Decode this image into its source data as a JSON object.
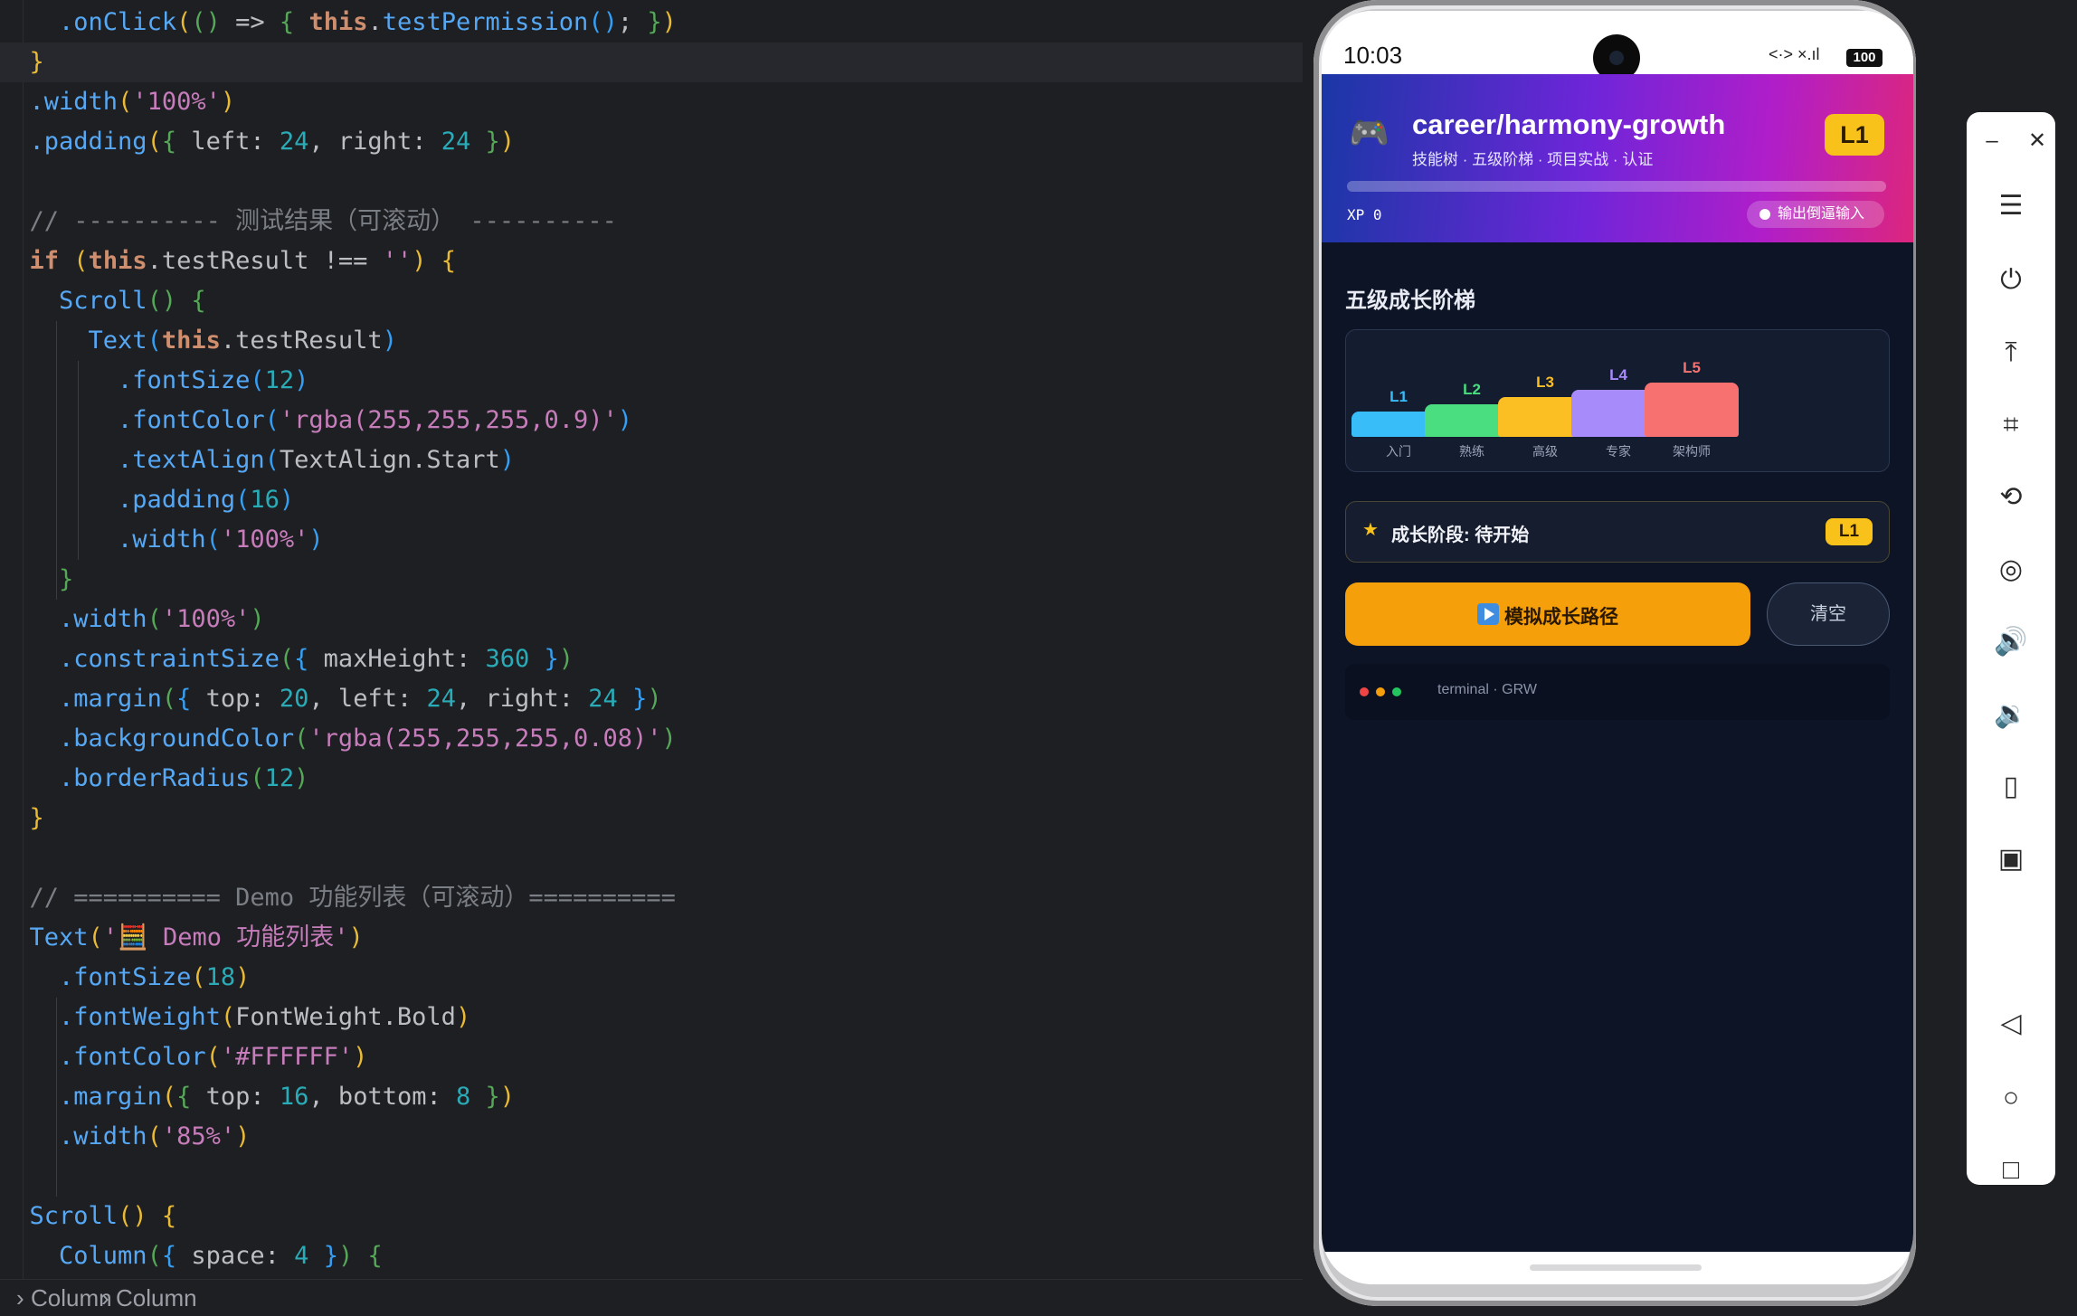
{
  "editor": {
    "lines": [
      [
        [
          "p",
          "    "
        ],
        [
          "fn",
          ".onClick"
        ],
        [
          "p1",
          "("
        ],
        [
          "p2",
          "("
        ],
        [
          "p2",
          ")"
        ],
        [
          "p",
          " => "
        ],
        [
          "p2",
          "{"
        ],
        [
          "p",
          " "
        ],
        [
          "kw",
          "this"
        ],
        [
          "p",
          "."
        ],
        [
          "fn",
          "testPermission"
        ],
        [
          "p3",
          "("
        ],
        [
          "p3",
          ")"
        ],
        [
          "p",
          "; "
        ],
        [
          "p2",
          "}"
        ],
        [
          "p1",
          ")"
        ]
      ],
      [
        [
          "p",
          "  "
        ],
        [
          "p1",
          "}"
        ]
      ],
      [
        [
          "p",
          "  "
        ],
        [
          "fn",
          ".width"
        ],
        [
          "p1",
          "("
        ],
        [
          "str",
          "'100%'"
        ],
        [
          "p1",
          ")"
        ]
      ],
      [
        [
          "p",
          "  "
        ],
        [
          "fn",
          ".padding"
        ],
        [
          "p1",
          "("
        ],
        [
          "p2",
          "{"
        ],
        [
          "p",
          " left: "
        ],
        [
          "num",
          "24"
        ],
        [
          "p",
          ", right: "
        ],
        [
          "num",
          "24"
        ],
        [
          "p",
          " "
        ],
        [
          "p2",
          "}"
        ],
        [
          "p1",
          ")"
        ]
      ],
      [],
      [
        [
          "p",
          "  "
        ],
        [
          "cm",
          "// ---------- 测试结果（可滚动） ----------"
        ]
      ],
      [
        [
          "p",
          "  "
        ],
        [
          "kw",
          "if"
        ],
        [
          "p",
          " "
        ],
        [
          "p1",
          "("
        ],
        [
          "kw",
          "this"
        ],
        [
          "p",
          ".testResult !== "
        ],
        [
          "str",
          "''"
        ],
        [
          "p1",
          ")"
        ],
        [
          "p",
          " "
        ],
        [
          "p1",
          "{"
        ]
      ],
      [
        [
          "p",
          "    "
        ],
        [
          "fn",
          "Scroll"
        ],
        [
          "p2",
          "("
        ],
        [
          "p2",
          ")"
        ],
        [
          "p",
          " "
        ],
        [
          "p2",
          "{"
        ]
      ],
      [
        [
          "p",
          "      "
        ],
        [
          "fn",
          "Text"
        ],
        [
          "p3",
          "("
        ],
        [
          "kw",
          "this"
        ],
        [
          "p",
          ".testResult"
        ],
        [
          "p3",
          ")"
        ]
      ],
      [
        [
          "p",
          "        "
        ],
        [
          "fn",
          ".fontSize"
        ],
        [
          "p3",
          "("
        ],
        [
          "num",
          "12"
        ],
        [
          "p3",
          ")"
        ]
      ],
      [
        [
          "p",
          "        "
        ],
        [
          "fn",
          ".fontColor"
        ],
        [
          "p3",
          "("
        ],
        [
          "str",
          "'rgba(255,255,255,0.9)'"
        ],
        [
          "p3",
          ")"
        ]
      ],
      [
        [
          "p",
          "        "
        ],
        [
          "fn",
          ".textAlign"
        ],
        [
          "p3",
          "("
        ],
        [
          "p",
          "TextAlign.Start"
        ],
        [
          "p3",
          ")"
        ]
      ],
      [
        [
          "p",
          "        "
        ],
        [
          "fn",
          ".padding"
        ],
        [
          "p3",
          "("
        ],
        [
          "num",
          "16"
        ],
        [
          "p3",
          ")"
        ]
      ],
      [
        [
          "p",
          "        "
        ],
        [
          "fn",
          ".width"
        ],
        [
          "p3",
          "("
        ],
        [
          "str",
          "'100%'"
        ],
        [
          "p3",
          ")"
        ]
      ],
      [
        [
          "p",
          "    "
        ],
        [
          "p2",
          "}"
        ]
      ],
      [
        [
          "p",
          "    "
        ],
        [
          "fn",
          ".width"
        ],
        [
          "p2",
          "("
        ],
        [
          "str",
          "'100%'"
        ],
        [
          "p2",
          ")"
        ]
      ],
      [
        [
          "p",
          "    "
        ],
        [
          "fn",
          ".constraintSize"
        ],
        [
          "p2",
          "("
        ],
        [
          "p3",
          "{"
        ],
        [
          "p",
          " maxHeight: "
        ],
        [
          "num",
          "360"
        ],
        [
          "p",
          " "
        ],
        [
          "p3",
          "}"
        ],
        [
          "p2",
          ")"
        ]
      ],
      [
        [
          "p",
          "    "
        ],
        [
          "fn",
          ".margin"
        ],
        [
          "p2",
          "("
        ],
        [
          "p3",
          "{"
        ],
        [
          "p",
          " top: "
        ],
        [
          "num",
          "20"
        ],
        [
          "p",
          ", left: "
        ],
        [
          "num",
          "24"
        ],
        [
          "p",
          ", right: "
        ],
        [
          "num",
          "24"
        ],
        [
          "p",
          " "
        ],
        [
          "p3",
          "}"
        ],
        [
          "p2",
          ")"
        ]
      ],
      [
        [
          "p",
          "    "
        ],
        [
          "fn",
          ".backgroundColor"
        ],
        [
          "p2",
          "("
        ],
        [
          "str",
          "'rgba(255,255,255,0.08)'"
        ],
        [
          "p2",
          ")"
        ]
      ],
      [
        [
          "p",
          "    "
        ],
        [
          "fn",
          ".borderRadius"
        ],
        [
          "p2",
          "("
        ],
        [
          "num",
          "12"
        ],
        [
          "p2",
          ")"
        ]
      ],
      [
        [
          "p",
          "  "
        ],
        [
          "p1",
          "}"
        ]
      ],
      [],
      [
        [
          "p",
          "  "
        ],
        [
          "cm",
          "// ========== Demo 功能列表（可滚动）=========="
        ]
      ],
      [
        [
          "p",
          "  "
        ],
        [
          "fn",
          "Text"
        ],
        [
          "p1",
          "("
        ],
        [
          "str",
          "'🧮 Demo 功能列表'"
        ],
        [
          "p1",
          ")"
        ]
      ],
      [
        [
          "p",
          "    "
        ],
        [
          "fn",
          ".fontSize"
        ],
        [
          "p1",
          "("
        ],
        [
          "num",
          "18"
        ],
        [
          "p1",
          ")"
        ]
      ],
      [
        [
          "p",
          "    "
        ],
        [
          "fn",
          ".fontWeight"
        ],
        [
          "p1",
          "("
        ],
        [
          "p",
          "FontWeight.Bold"
        ],
        [
          "p1",
          ")"
        ]
      ],
      [
        [
          "p",
          "    "
        ],
        [
          "fn",
          ".fontColor"
        ],
        [
          "p1",
          "("
        ],
        [
          "str",
          "'#FFFFFF'"
        ],
        [
          "p1",
          ")"
        ]
      ],
      [
        [
          "p",
          "    "
        ],
        [
          "fn",
          ".margin"
        ],
        [
          "p1",
          "("
        ],
        [
          "p2",
          "{"
        ],
        [
          "p",
          " top: "
        ],
        [
          "num",
          "16"
        ],
        [
          "p",
          ", bottom: "
        ],
        [
          "num",
          "8"
        ],
        [
          "p",
          " "
        ],
        [
          "p2",
          "}"
        ],
        [
          "p1",
          ")"
        ]
      ],
      [
        [
          "p",
          "    "
        ],
        [
          "fn",
          ".width"
        ],
        [
          "p1",
          "("
        ],
        [
          "str",
          "'85%'"
        ],
        [
          "p1",
          ")"
        ]
      ],
      [],
      [
        [
          "p",
          "  "
        ],
        [
          "fn",
          "Scroll"
        ],
        [
          "p1",
          "("
        ],
        [
          "p1",
          ")"
        ],
        [
          "p",
          " "
        ],
        [
          "p1",
          "{"
        ]
      ],
      [
        [
          "p",
          "    "
        ],
        [
          "fn",
          "Column"
        ],
        [
          "p2",
          "("
        ],
        [
          "p3",
          "{"
        ],
        [
          "p",
          " space: "
        ],
        [
          "num",
          "4"
        ],
        [
          "p",
          " "
        ],
        [
          "p3",
          "}"
        ],
        [
          "p2",
          ")"
        ],
        [
          "p",
          " "
        ],
        [
          "p2",
          "{"
        ]
      ]
    ]
  },
  "breadcrumb": {
    "sep": "›",
    "items": [
      "Column",
      "Column"
    ]
  },
  "phone": {
    "status": {
      "time": "10:03",
      "signal": "<·> ×.ıl",
      "battery": "100"
    },
    "header": {
      "icon": "gamepad-icon",
      "title": "career/harmony-growth",
      "subtitle": "技能树 · 五级阶梯 · 项目实战 · 认证",
      "level": "L1",
      "xp_label": "XP 0",
      "xp_progress": 0,
      "reverse_label": "输出倒逼输入"
    },
    "ladder": {
      "title": "五级成长阶梯",
      "levels": [
        {
          "level": "L1",
          "name": "入门",
          "color": "#38bdf8"
        },
        {
          "level": "L2",
          "name": "熟练",
          "color": "#4ade80"
        },
        {
          "level": "L3",
          "name": "高级",
          "color": "#fbbf24"
        },
        {
          "level": "L4",
          "name": "专家",
          "color": "#a78bfa"
        },
        {
          "level": "L5",
          "name": "架构师",
          "color": "#f87171"
        }
      ]
    },
    "stage": {
      "icon": "star-icon",
      "text": "成长阶段: 待开始",
      "level": "L1"
    },
    "buttons": {
      "simulate": "模拟成长路径",
      "clear": "清空"
    },
    "terminal": {
      "label": "terminal · GRW",
      "dots": [
        "#ef4444",
        "#f59e0b",
        "#22c55e"
      ]
    }
  },
  "toolbar": {
    "buttons": [
      {
        "name": "minimize-button",
        "icon": "–"
      },
      {
        "name": "close-button",
        "icon": "✕"
      },
      {
        "name": "menu-button",
        "icon": "☰"
      },
      {
        "name": "power-button",
        "icon": "⏻"
      },
      {
        "name": "top-button",
        "icon": "⤒"
      },
      {
        "name": "crop-button",
        "icon": "⌗"
      },
      {
        "name": "rotate-button",
        "icon": "⟲"
      },
      {
        "name": "screenshot-button",
        "icon": "◎"
      },
      {
        "name": "volume-up-button",
        "icon": "🔊"
      },
      {
        "name": "volume-down-button",
        "icon": "🔉"
      },
      {
        "name": "shake-button",
        "icon": "▯"
      },
      {
        "name": "multi-device-button",
        "icon": "▣"
      },
      {
        "name": "back-button",
        "icon": "◁"
      },
      {
        "name": "home-button",
        "icon": "○"
      },
      {
        "name": "recent-button",
        "icon": "□"
      }
    ]
  }
}
